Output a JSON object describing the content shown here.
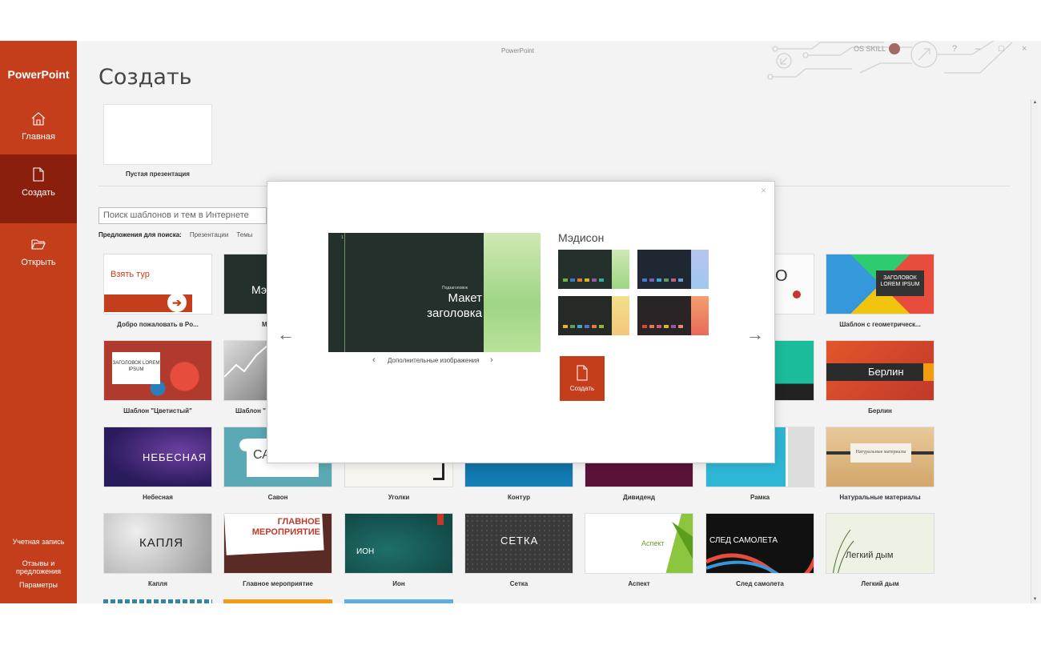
{
  "window": {
    "title": "PowerPoint",
    "user": "OS SKILL"
  },
  "sidebar": {
    "app_name": "PowerPoint",
    "items": [
      {
        "label": "Главная",
        "icon": "home-icon"
      },
      {
        "label": "Создать",
        "icon": "new-document-icon"
      },
      {
        "label": "Открыть",
        "icon": "folder-open-icon"
      }
    ],
    "footer": [
      "Учетная запись",
      "Отзывы и предложения",
      "Параметры"
    ]
  },
  "main": {
    "title": "Создать",
    "blank": {
      "label": "Пустая презентация"
    },
    "search": {
      "placeholder": "Поиск шаблонов и тем в Интернете"
    },
    "suggest": {
      "label": "Предложения для поиска:",
      "links": [
        "Презентации",
        "Темы"
      ]
    }
  },
  "templates": [
    {
      "label": "Добро пожаловать в Po...",
      "thumb_text": "Взять тур"
    },
    {
      "label": "М",
      "thumb_text": "Мэ"
    },
    {
      "label": "Шаблон с геометрическ...",
      "thumb_text": "ЗАГОЛОВОК LOREM IPSUM"
    },
    {
      "label": "Шаблон \"Цветистый\"",
      "thumb_text": "ЗАГОЛОВОК LOREM IPSUM"
    },
    {
      "label": "Шаблон \"",
      "thumb_text": ""
    },
    {
      "label": "Берлин",
      "thumb_text": "Берлин"
    },
    {
      "label": "Небесная",
      "thumb_text": "НЕБЕСНАЯ"
    },
    {
      "label": "Савон",
      "thumb_text": "СА"
    },
    {
      "label": "Уголки",
      "thumb_text": ""
    },
    {
      "label": "Контур",
      "thumb_text": ""
    },
    {
      "label": "Дивиденд",
      "thumb_text": ""
    },
    {
      "label": "Рамка",
      "thumb_text": ""
    },
    {
      "label": "Натуральные материалы",
      "thumb_text": "Натуральные материалы"
    },
    {
      "label": "Капля",
      "thumb_text": "КАПЛЯ"
    },
    {
      "label": "Главное мероприятие",
      "thumb_text": "ГЛАВНОЕ МЕРОПРИЯТИЕ"
    },
    {
      "label": "Ион",
      "thumb_text": "ИОН"
    },
    {
      "label": "Сетка",
      "thumb_text": "СЕТКА"
    },
    {
      "label": "Аспект",
      "thumb_text": "Аспект"
    },
    {
      "label": "След самолета",
      "thumb_text": "СЛЕД САМОЛЕТА"
    },
    {
      "label": "Легкий дым",
      "thumb_text": "Легкий дым"
    },
    {
      "label": "",
      "thumb_text": "О"
    }
  ],
  "modal": {
    "theme_name": "Мэдисон",
    "preview": {
      "slide_number": "1",
      "subtitle": "Подзаголовок",
      "title": "Макет заголовка"
    },
    "more_images": "Дополнительные изображения",
    "create_label": "Создать",
    "close_glyph": "×",
    "prev_glyph": "←",
    "next_glyph": "→"
  },
  "colors": {
    "accent": "#c43e1c",
    "accent_dark": "#8b1f0d",
    "madison_dark": "#23302b",
    "madison_green": "#a6d98a"
  }
}
